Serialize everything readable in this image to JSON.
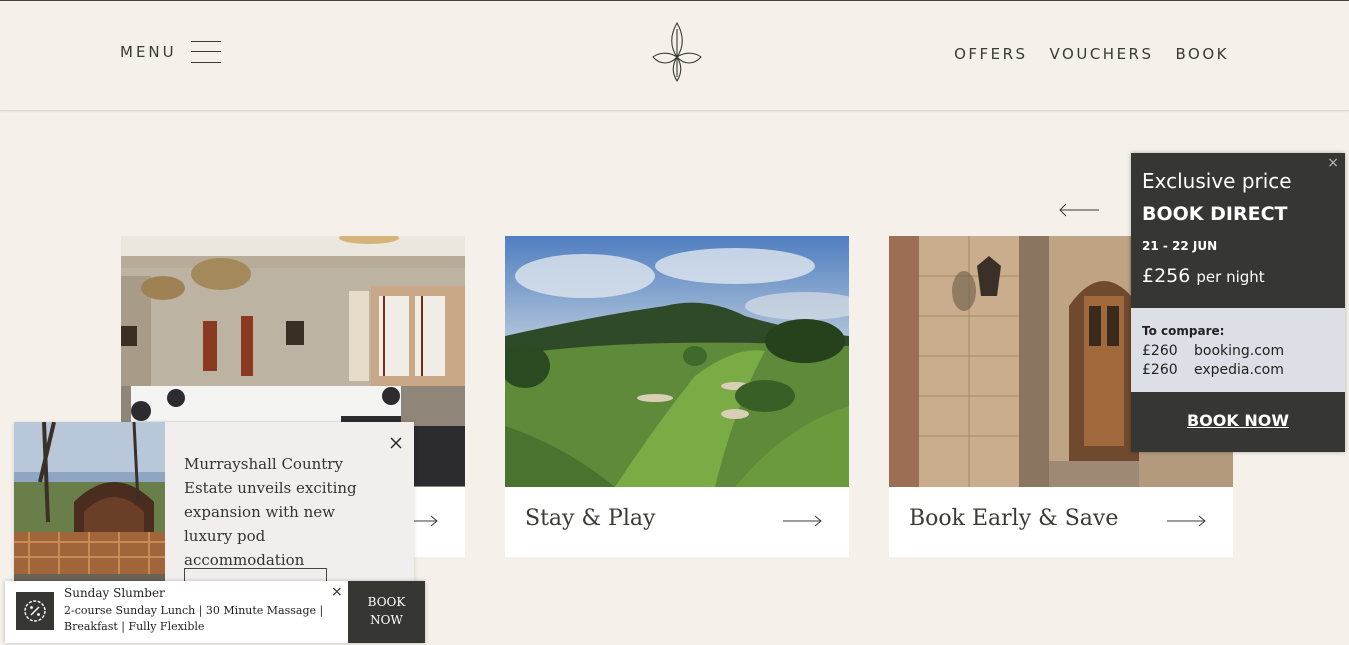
{
  "header": {
    "menu_label": "MENU",
    "nav": [
      "OFFERS",
      "VOUCHERS",
      "BOOK"
    ]
  },
  "cards": [
    {
      "label": ""
    },
    {
      "label": "Stay & Play"
    },
    {
      "label": "Book Early & Save"
    }
  ],
  "price_widget": {
    "close": "×",
    "title": "Exclusive price",
    "book_direct": "BOOK DIRECT",
    "dates": "21 - 22 JUN",
    "price": "£256",
    "per_night": "per night",
    "compare_title": "To compare:",
    "compare": [
      {
        "price": "£260",
        "site": "booking.com"
      },
      {
        "price": "£260",
        "site": "expedia.com"
      }
    ],
    "cta": "BOOK NOW"
  },
  "news_popup": {
    "text": "Murrayshall Country Estate unveils exciting expansion with new luxury pod accommodation"
  },
  "offer_bar": {
    "title": "Sunday Slumber",
    "description": "2-course Sunday Lunch | 30 Minute Massage | Breakfast | Fully Flexible",
    "close": "×",
    "cta_line1": "BOOK",
    "cta_line2": "NOW"
  },
  "colors": {
    "background": "#f5f1ea",
    "dark": "#363632",
    "compare_bg": "#dddfe6"
  }
}
